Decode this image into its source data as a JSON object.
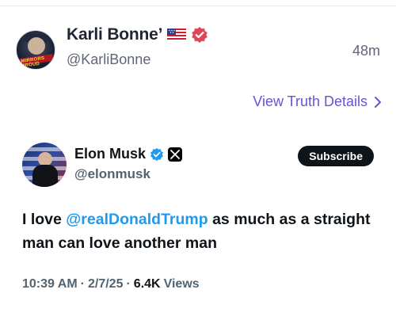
{
  "truth_post": {
    "display_name": "Karli Bonne’",
    "handle": "@KarliBonne",
    "time_ago": "48m",
    "avatar_text": "MIRRORS PROUD",
    "view_details_label": "View Truth Details",
    "colors": {
      "verified_badge": "#e0455a",
      "link": "#6a52d6"
    }
  },
  "embedded_post": {
    "display_name": "Elon Musk",
    "handle": "@elonmusk",
    "subscribe_label": "Subscribe",
    "text_before": "I love ",
    "mention": "@realDonaldTrump",
    "text_after": " as much as a straight man can love another man",
    "time": "10:39 AM",
    "date": "2/7/25",
    "separator": "·",
    "views_count": "6.4K",
    "views_label": "Views",
    "colors": {
      "verified_badge": "#1d9bf0",
      "mention": "#1d9bf0"
    }
  }
}
